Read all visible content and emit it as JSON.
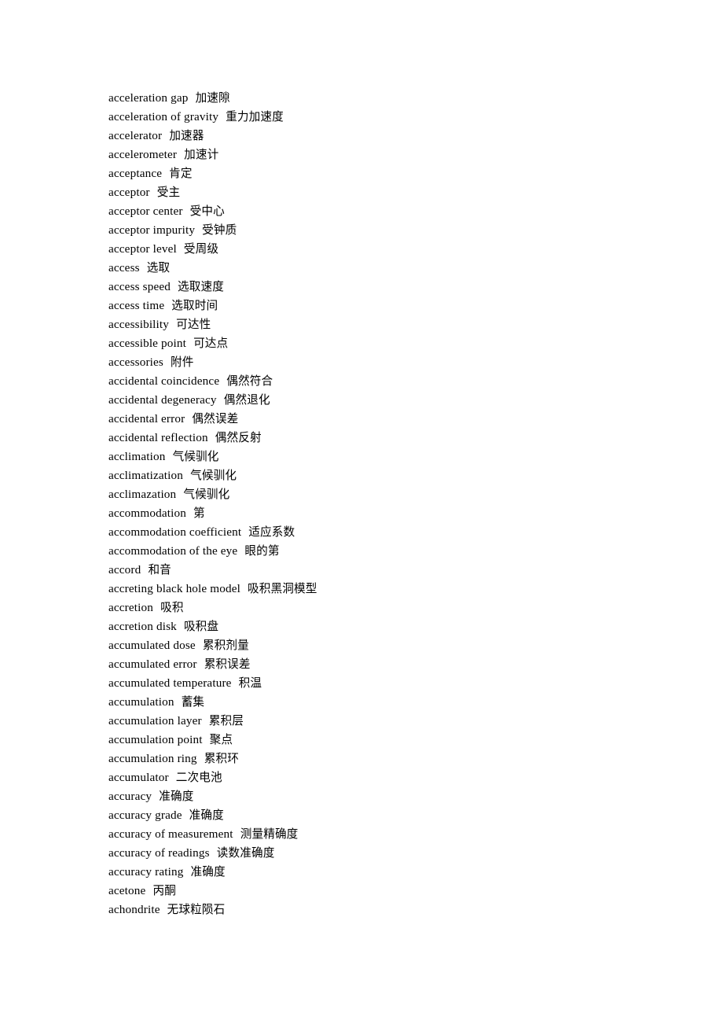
{
  "document": {
    "page_background": "#ffffff",
    "text_color": "#000000",
    "entries": [
      {
        "term": "acceleration gap",
        "gloss": "加速隙"
      },
      {
        "term": "acceleration of gravity",
        "gloss": "重力加速度"
      },
      {
        "term": "accelerator",
        "gloss": "加速器"
      },
      {
        "term": "accelerometer",
        "gloss": "加速计"
      },
      {
        "term": "acceptance",
        "gloss": "肯定"
      },
      {
        "term": "acceptor",
        "gloss": "受主"
      },
      {
        "term": "acceptor center",
        "gloss": "受中心"
      },
      {
        "term": "acceptor impurity",
        "gloss": "受钟质"
      },
      {
        "term": "acceptor level",
        "gloss": "受周级"
      },
      {
        "term": "access",
        "gloss": "选取"
      },
      {
        "term": "access speed",
        "gloss": "选取速度"
      },
      {
        "term": "access time",
        "gloss": "选取时间"
      },
      {
        "term": "accessibility",
        "gloss": "可达性"
      },
      {
        "term": "accessible point",
        "gloss": "可达点"
      },
      {
        "term": "accessories",
        "gloss": "附件"
      },
      {
        "term": "accidental coincidence",
        "gloss": "偶然符合"
      },
      {
        "term": "accidental degeneracy",
        "gloss": "偶然退化"
      },
      {
        "term": "accidental error",
        "gloss": "偶然误差"
      },
      {
        "term": "accidental reflection",
        "gloss": "偶然反射"
      },
      {
        "term": "acclimation",
        "gloss": "气候驯化"
      },
      {
        "term": "acclimatization",
        "gloss": "气候驯化"
      },
      {
        "term": "acclimazation",
        "gloss": "气候驯化"
      },
      {
        "term": "accommodation",
        "gloss": "第"
      },
      {
        "term": "accommodation coefficient",
        "gloss": "适应系数"
      },
      {
        "term": "accommodation of the eye",
        "gloss": "眼的第"
      },
      {
        "term": "accord",
        "gloss": "和音"
      },
      {
        "term": "accreting black hole model",
        "gloss": "吸积黑洞模型"
      },
      {
        "term": "accretion",
        "gloss": "吸积"
      },
      {
        "term": "accretion disk",
        "gloss": "吸积盘"
      },
      {
        "term": "accumulated dose",
        "gloss": "累积剂量"
      },
      {
        "term": "accumulated error",
        "gloss": "累积误差"
      },
      {
        "term": "accumulated temperature",
        "gloss": "积温"
      },
      {
        "term": "accumulation",
        "gloss": "蓄集"
      },
      {
        "term": "accumulation layer",
        "gloss": "累积层"
      },
      {
        "term": "accumulation point",
        "gloss": "聚点"
      },
      {
        "term": "accumulation ring",
        "gloss": "累积环"
      },
      {
        "term": "accumulator",
        "gloss": "二次电池"
      },
      {
        "term": "accuracy",
        "gloss": "准确度"
      },
      {
        "term": "accuracy grade",
        "gloss": "准确度"
      },
      {
        "term": "accuracy of measurement",
        "gloss": "测量精确度"
      },
      {
        "term": "accuracy of readings",
        "gloss": "读数准确度"
      },
      {
        "term": "accuracy rating",
        "gloss": "准确度"
      },
      {
        "term": "acetone",
        "gloss": "丙酮"
      },
      {
        "term": "achondrite",
        "gloss": "无球粒陨石"
      }
    ]
  }
}
